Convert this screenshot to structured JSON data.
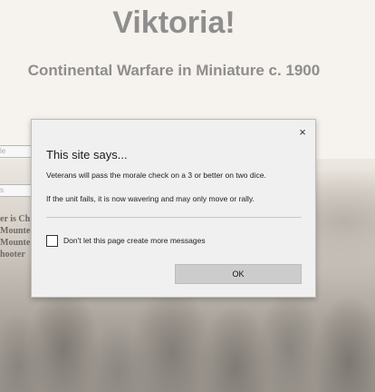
{
  "background_page": {
    "title": "Viktoria!",
    "subtitle": "Continental Warfare in Miniature c. 1900",
    "field_1_value": "le",
    "field_2_value": "s",
    "text_lines": [
      "er is Ch",
      "Mounted",
      "Mounte",
      "hooter"
    ]
  },
  "dialog": {
    "close_glyph": "×",
    "title": "This site says...",
    "message_line_1": "Veterans will pass the morale check on a 3 or better on two dice.",
    "message_line_2": "If the unit fails, it is now wavering and may only move or rally.",
    "checkbox_label": "Don't let this page create more messages",
    "checkbox_checked": false,
    "ok_label": "OK"
  }
}
